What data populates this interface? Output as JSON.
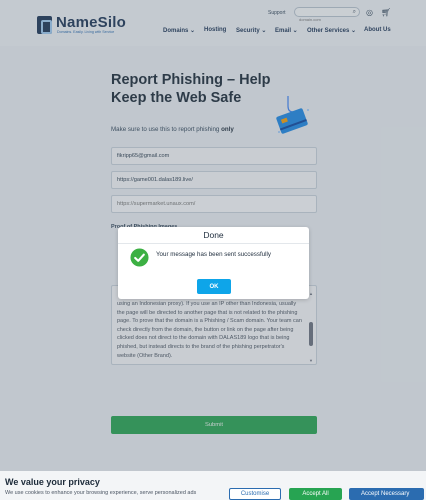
{
  "header": {
    "support_label": "Support",
    "search_placeholder": "domain.com",
    "logo_text": "NameSilo",
    "logo_tagline": "Domains. Easily. Living with Service",
    "nav": [
      "Domains",
      "Hosting",
      "Security",
      "Email",
      "Other Services",
      "About Us"
    ]
  },
  "form": {
    "title": "Report Phishing – Help Keep the Web Safe",
    "subtitle_prefix": "Make sure to use this to report phishing",
    "subtitle_emph": "only",
    "email_value": "fikripp65@gmail.com",
    "phishing_url_value": "https://game001.dalas189.live/",
    "legit_url_placeholder": "https://supermarket.unaux.com/",
    "proof_label": "Proof of Phishing Images",
    "description_text": "using an Indonesian proxy). If you use an IP other than Indonesia, usually the page will be directed to another page that is not related to the phishing page. To prove that the domain is a Phishing / Scam domain. Your team can check directly from the domain, the button or link on the page after being clicked does not direct to the domain with DALAS189 logo that is being phished, but instead directs to the brand of the phishing perpetrator's website (Other Brand).",
    "submit_label": "Submit"
  },
  "modal": {
    "title": "Done",
    "message": "Your message has been sent successfully",
    "ok_label": "OK"
  },
  "cookie": {
    "title": "We value your privacy",
    "text": "We use cookies to enhance your browsing experience, serve personalized ads",
    "customise_label": "Customise",
    "accept_label": "Accept All",
    "necessary_label": "Accept Necessary"
  },
  "colors": {
    "brand": "#1d3557",
    "submit_green": "#27a452",
    "ok_blue": "#0ea5e9",
    "success_green": "#3cb043"
  }
}
